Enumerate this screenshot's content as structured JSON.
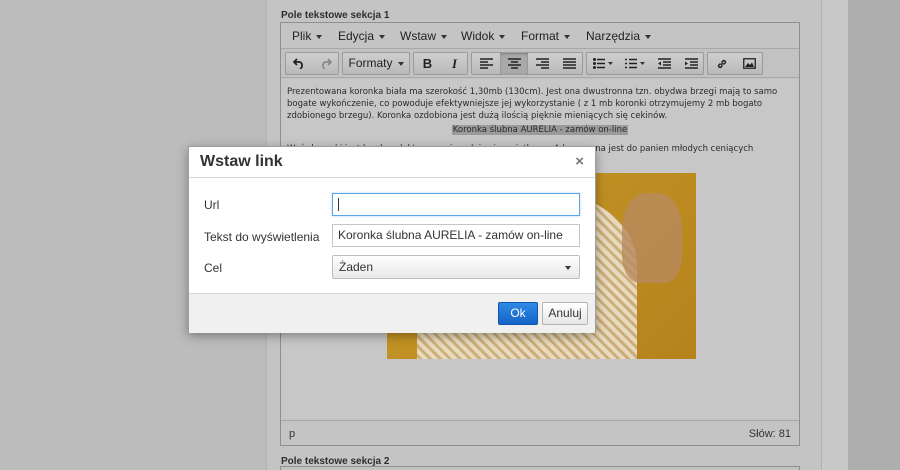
{
  "sections": {
    "section1_title": "Pole tekstowe sekcja 1",
    "section2_title": "Pole tekstowe sekcja 2"
  },
  "menubar": {
    "items": [
      {
        "label": "Plik"
      },
      {
        "label": "Edycja"
      },
      {
        "label": "Wstaw"
      },
      {
        "label": "Widok"
      },
      {
        "label": "Format"
      },
      {
        "label": "Narzędzia"
      }
    ]
  },
  "toolbar": {
    "formats_label": "Formaty",
    "bold_label": "B",
    "italic_label": "I",
    "icons": [
      "undo-icon",
      "redo-icon",
      "bold-icon",
      "italic-icon",
      "align-left-icon",
      "align-center-icon",
      "align-right-icon",
      "align-justify-icon",
      "bullet-list-icon",
      "numbered-list-icon",
      "outdent-icon",
      "indent-icon",
      "link-icon",
      "image-icon"
    ]
  },
  "content": {
    "paragraph1": "Prezentowana koronka biała ma szerokość 1,30mb (130cm). Jest ona dwustronna tzn. obydwa brzegi mają to samo bogate wykończenie, co powoduje efektywniejsze jej wykorzystanie ( z 1 mb koronki otrzymujemy 2 mb bogato zdobionego brzegu). Koronka ozdobiona jest dużą ilością pięknie mieniących się cekinów.",
    "link_text": "Koronka ślubna AURELIA - zamów on-line",
    "paragraph3": "Wzór koronki jest bardzo elektowny...ciomaluje się wyjątkowo. Adresowana jest do panien młodych ceniących klasyczne, elegancki..."
  },
  "statusbar": {
    "path": "p",
    "word_count": "Słów: 81"
  },
  "dialog": {
    "title": "Wstaw link",
    "close_glyph": "×",
    "url_label": "Url",
    "url_value": "",
    "text_label": "Tekst do wyświetlenia",
    "text_value": "Koronka ślubna AURELIA - zamów on-line",
    "target_label": "Cel",
    "target_value": "Żaden",
    "ok_label": "Ok",
    "cancel_label": "Anuluj"
  }
}
